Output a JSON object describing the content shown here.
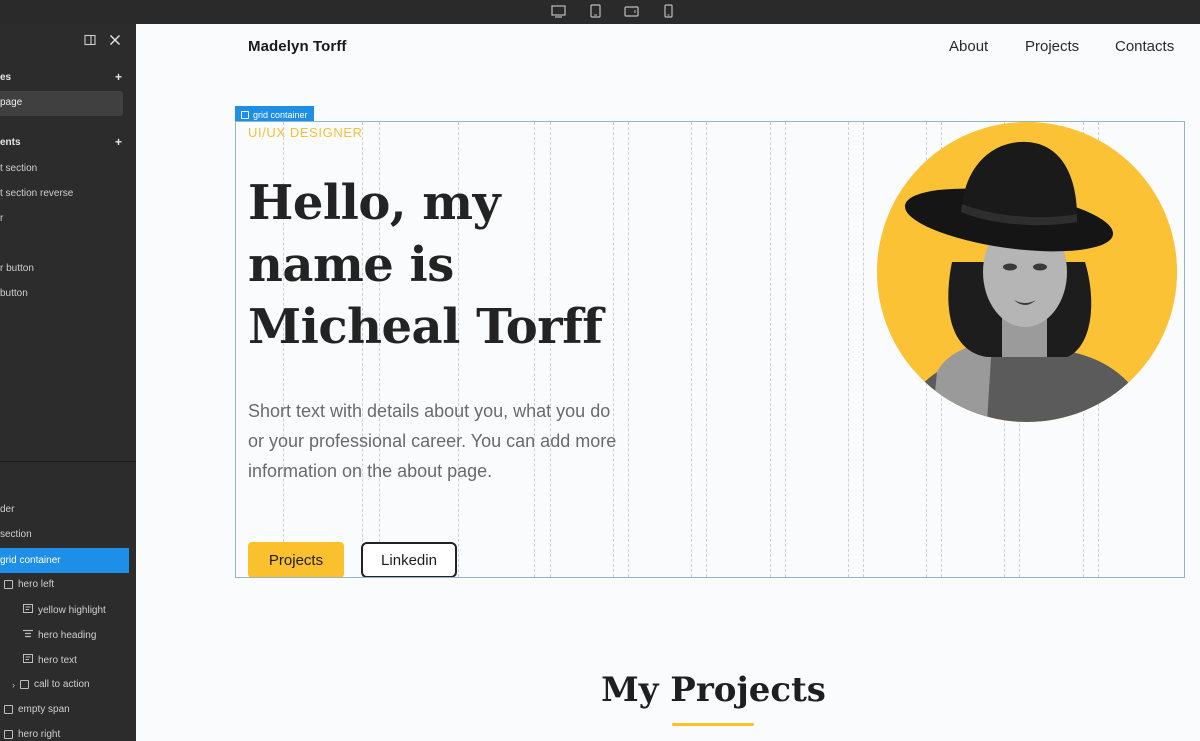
{
  "toolbar": {
    "devices": [
      "desktop-icon",
      "tablet-icon",
      "tablet-landscape-icon",
      "mobile-icon"
    ]
  },
  "left_panel": {
    "pages_heading": "es",
    "page_item": "page",
    "components_heading": "ents",
    "components": [
      "t section",
      "t section reverse",
      "r",
      "",
      "r button",
      "button"
    ],
    "tree": {
      "items": [
        {
          "label": "der"
        },
        {
          "label": "section"
        },
        {
          "label": "grid container"
        },
        {
          "label": "hero left"
        },
        {
          "label": "yellow highlight"
        },
        {
          "label": "hero heading"
        },
        {
          "label": "hero text"
        },
        {
          "label": "call to action"
        },
        {
          "label": "empty span"
        },
        {
          "label": "hero right"
        }
      ]
    }
  },
  "site": {
    "brand": "Madelyn Torff",
    "nav": [
      "About",
      "Projects",
      "Contacts"
    ],
    "grid_tag": "grid container",
    "eyebrow": "UI/UX DESIGNER",
    "hero_heading_lines": [
      "Hello, my",
      "name is",
      "Micheal Torff"
    ],
    "hero_text": "Short text with details about you, what you do or your professional career. You can add more information on the about page.",
    "btn_projects": "Projects",
    "btn_linkedin": "Linkedin",
    "projects_title": "My Projects"
  },
  "colors": {
    "accent": "#fbc02d",
    "selection": "#1e8fe8",
    "panel_bg": "#2c2c2c",
    "canvas_bg": "#fafbfc"
  }
}
